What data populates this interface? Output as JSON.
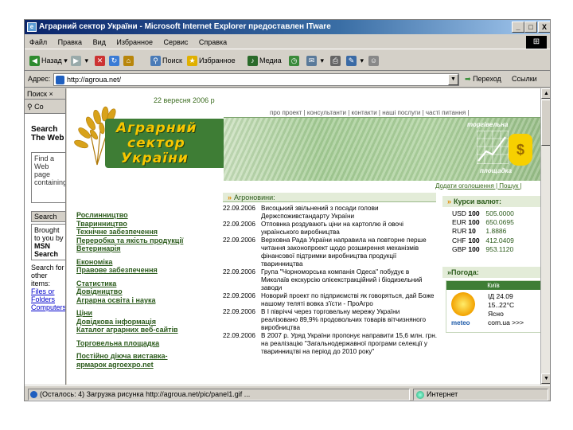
{
  "window": {
    "title": "Аграрний сектор України - Microsoft Internet Explorer предоставлен ITware",
    "minimize": "_",
    "maximize": "□",
    "close": "X"
  },
  "menu": [
    "Файл",
    "Правка",
    "Вид",
    "Избранное",
    "Сервис",
    "Справка"
  ],
  "toolbar": {
    "back": "Назад",
    "search": "Поиск",
    "favorites": "Избранное",
    "media": "Медиа"
  },
  "address": {
    "label": "Адрес:",
    "url": "http://agroua.net/",
    "go": "Переход",
    "links": "Ссылки"
  },
  "sidebar": {
    "header": "Поиск",
    "header2": "Co",
    "title": "Search The Web",
    "box_text": "Find a Web page containing",
    "button": "Search",
    "msn_text": "Brought to you by",
    "msn_brand": "MSN Search",
    "foot_text": "Search for other items:",
    "foot_links": [
      "Files or Folders",
      "Computers"
    ]
  },
  "page": {
    "date": "22 вересня 2006 р",
    "logo": [
      "Аграрний",
      "сектор",
      "України"
    ],
    "topnav": "про проект | консультанти | контакти | наші послуги | часті питання |",
    "trade_top": "торгівельна",
    "trade_bottom": "площадка",
    "sublinks": "Додати оголошення | Пошук | ",
    "nav": [
      "Рослинництво",
      "Тваринництво",
      "Технічне забезпечення",
      "Переробка та якість продукції",
      "Ветеринарія",
      "",
      "Економіка",
      "Правове забезпечення",
      "",
      "Статистика",
      "Довідництво",
      "Аграрна освіта і наука",
      "",
      "Ціни",
      "Довідкова інформація",
      "Каталог аграрних веб-сайтів",
      "",
      "Торговельна площадка",
      "",
      "Постійно діюча виставка-",
      "ярмарок agroexpo.net"
    ],
    "news_header": "Агроновини:",
    "news": [
      {
        "date": "22.09.2006",
        "text": "Висоцький звільнений з посади голови Держспоживстандарту України"
      },
      {
        "date": "22.09.2006",
        "text": "Отповнка роздувають ціни на картоплю й овочі українського виробництва"
      },
      {
        "date": "22.09.2006",
        "text": "Верховна Рада України направила на повторне перше читання законопроект щодо розширення механізмів фінансової підтримки виробництва продукції тваринництва"
      },
      {
        "date": "22.09.2006",
        "text": "Група \"Чорноморська компанія Одеса\" побудує в Миколаїв екскурсію олієекстракційний і біодизельний заводи"
      },
      {
        "date": "22.09.2006",
        "text": "Новорий проект по підприємстві як говоряться, дай Боже нашому теляті вовка з'їсти - ПроАгро"
      },
      {
        "date": "22.09.2006",
        "text": "В I півріччі через торговельну мережу України реалізовано 89,9% продовольчих товарів вітчизняного виробництва"
      },
      {
        "date": "22.09.2006",
        "text": "В 2007 р. Уряд України пропонує направити 15,6 млн. грн. на реалізацію \"Загальнодержавної програми селекції у тваринництві на період до 2010 року\""
      }
    ],
    "rates_header": "Курси валют:",
    "rates": [
      {
        "code": "USD",
        "unit": "100",
        "value": "505.0000"
      },
      {
        "code": "EUR",
        "unit": "100",
        "value": "650.0695"
      },
      {
        "code": "RUR",
        "unit": "10",
        "value": "1.8886"
      },
      {
        "code": "CHF",
        "unit": "100",
        "value": "412.0409"
      },
      {
        "code": "GBP",
        "unit": "100",
        "value": "953.1120"
      }
    ],
    "weather_header": "Погода:",
    "weather": {
      "city": "Київ",
      "line1": "ІД 24.09",
      "line2": "15..22°C",
      "line3": "Ясно",
      "line4": "com.ua >>>",
      "brand": "meteo"
    }
  },
  "status": {
    "text": "(Осталось: 4) Загрузка рисунка http://agroua.net/pic/panel1.gif ...",
    "zone": "Интернет"
  },
  "colors": {
    "brand_green": "#3e7d35",
    "logo_yellow": "#f7c600",
    "title_blue": "#0a246a"
  }
}
